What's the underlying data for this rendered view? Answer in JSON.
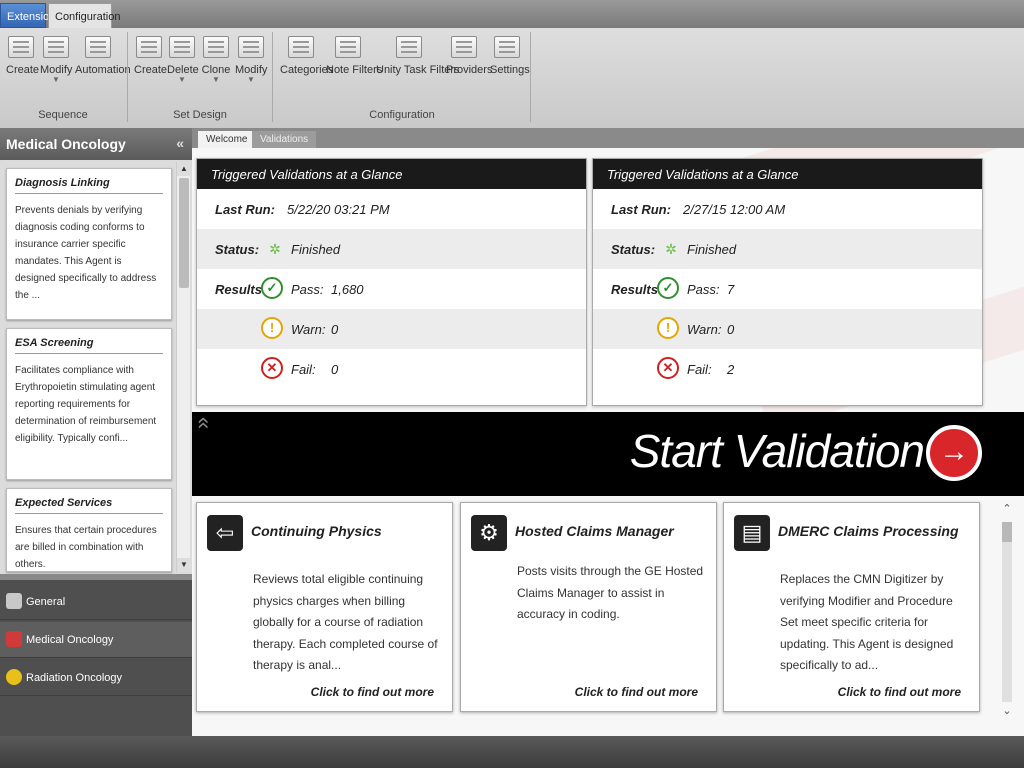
{
  "ribbon": {
    "tabs": [
      {
        "label": "Extension"
      },
      {
        "label": "Configuration"
      }
    ],
    "groups": [
      {
        "label": "Sequence",
        "buttons": [
          {
            "label": "Create"
          },
          {
            "label": "Modify"
          },
          {
            "label": "Automation"
          }
        ]
      },
      {
        "label": "Set Design",
        "buttons": [
          {
            "label": "Create"
          },
          {
            "label": "Delete"
          },
          {
            "label": "Clone"
          },
          {
            "label": "Modify"
          }
        ]
      },
      {
        "label": "Configuration",
        "buttons": [
          {
            "label": "Categories"
          },
          {
            "label": "Note Filters"
          },
          {
            "label": "Unity Task Filters"
          },
          {
            "label": "Providers"
          },
          {
            "label": "Settings"
          }
        ]
      }
    ]
  },
  "left_panel": {
    "title": "Medical Oncology",
    "agents": [
      {
        "title": "Diagnosis Linking",
        "desc": "Prevents denials by verifying diagnosis coding conforms to insurance carrier specific mandates. This Agent is designed specifically to address the ..."
      },
      {
        "title": "ESA Screening",
        "desc": "Facilitates compliance with Erythropoietin stimulating agent reporting requirements for determination of reimbursement eligibility. Typically confi..."
      },
      {
        "title": "Expected Services",
        "desc": "Ensures that certain procedures are billed in combination with others."
      }
    ],
    "categories": [
      {
        "label": "General",
        "color": "#c8c8c8"
      },
      {
        "label": "Medical Oncology",
        "color": "#d03a3a"
      },
      {
        "label": "Radiation Oncology",
        "color": "#e8c01a"
      }
    ]
  },
  "main_tabs": [
    {
      "label": "Welcome"
    },
    {
      "label": "Validations"
    }
  ],
  "summaries": [
    {
      "title": "Triggered Validations at a Glance",
      "last_run_label": "Last Run:",
      "last_run": "5/22/20 03:21 PM",
      "status_label": "Status:",
      "status": "Finished",
      "results_label": "Results:",
      "pass_label": "Pass:",
      "pass": "1,680",
      "warn_label": "Warn:",
      "warn": "0",
      "fail_label": "Fail:",
      "fail": "0"
    },
    {
      "title": "Triggered Validations at a Glance",
      "last_run_label": "Last Run:",
      "last_run": "2/27/15 12:00 AM",
      "status_label": "Status:",
      "status": "Finished",
      "results_label": "Results:",
      "pass_label": "Pass:",
      "pass": "7",
      "warn_label": "Warn:",
      "warn": "0",
      "fail_label": "Fail:",
      "fail": "2"
    }
  ],
  "start_validation": {
    "label": "Start Validation"
  },
  "agent_tiles": [
    {
      "title": "Continuing Physics",
      "icon": "arrow-back-icon",
      "desc": "Reviews total eligible continuing physics charges when billing globally for a course of radiation therapy. Each completed course of therapy is anal...",
      "link": "Click to find out more"
    },
    {
      "title": "Hosted Claims Manager",
      "icon": "gear-icon",
      "desc": "Posts visits through the GE Hosted Claims Manager to assist in accuracy in coding.",
      "link": "Click to find out more"
    },
    {
      "title": "DMERC Claims Processing",
      "icon": "document-icon",
      "desc": "Replaces the CMN Digitizer by verifying Modifier and Procedure Set meet specific criteria for updating. This Agent is designed specifically to ad...",
      "link": "Click to find out more"
    }
  ]
}
